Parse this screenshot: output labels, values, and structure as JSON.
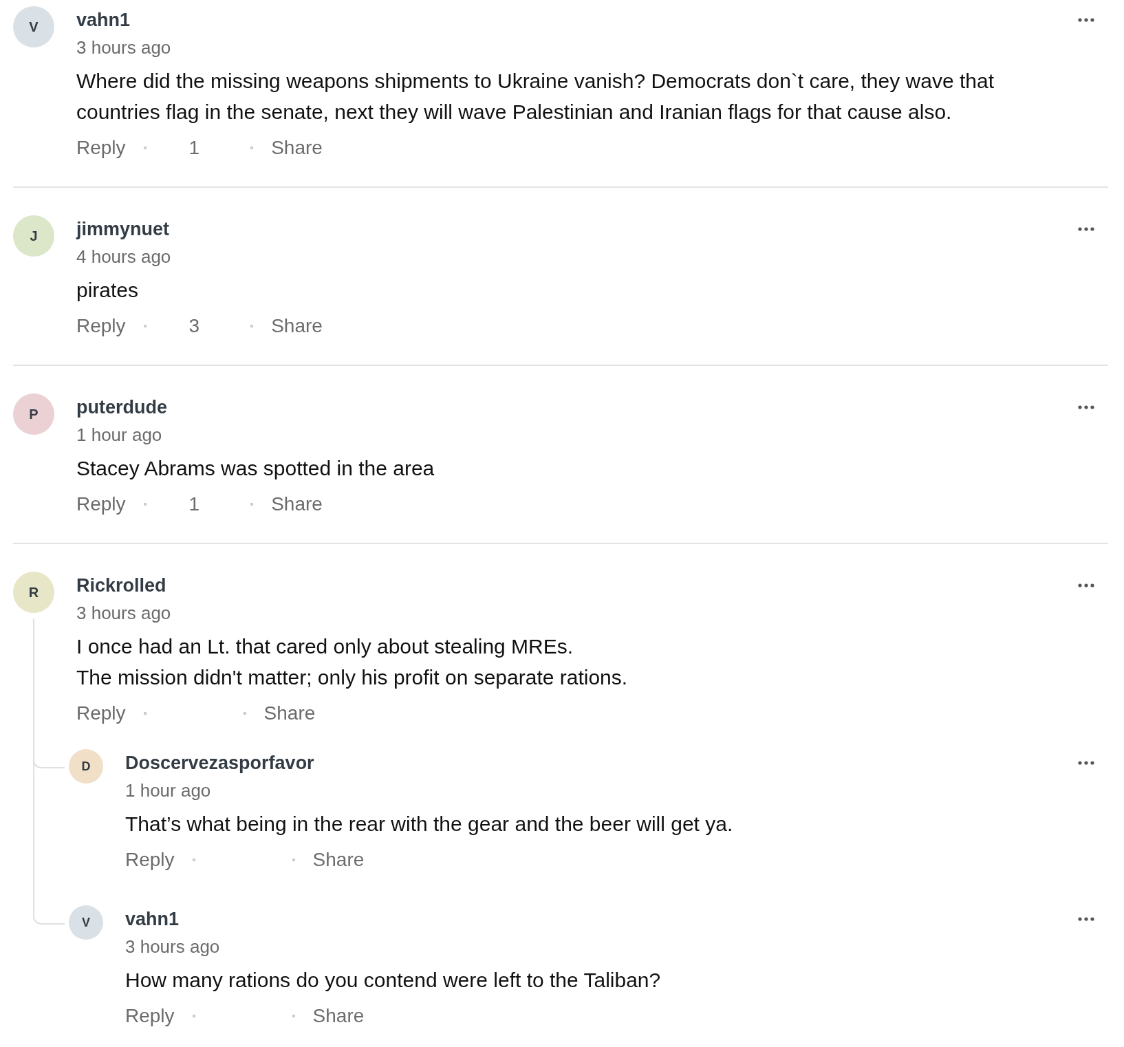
{
  "comments": [
    {
      "author": "vahn1",
      "initial": "V",
      "color": "#d9e1e6",
      "time": "3 hours ago",
      "body": [
        "Where did the missing weapons shipments to Ukraine vanish? Democrats don`t care, they wave that countries flag in the senate, next they will wave Palestinian and Iranian flags for that cause also."
      ],
      "reply": "Reply",
      "count": "1",
      "share": "Share"
    },
    {
      "author": "jimmynuet",
      "initial": "J",
      "color": "#dce6c9",
      "time": "4 hours ago",
      "body": [
        "pirates"
      ],
      "reply": "Reply",
      "count": "3",
      "share": "Share"
    },
    {
      "author": "puterdude",
      "initial": "P",
      "color": "#ecd1d4",
      "time": "1 hour ago",
      "body": [
        "Stacey Abrams was spotted in the area"
      ],
      "reply": "Reply",
      "count": "1",
      "share": "Share"
    },
    {
      "author": "Rickrolled",
      "initial": "R",
      "color": "#e7e7c7",
      "time": "3 hours ago",
      "body": [
        "I once had an Lt. that cared only about stealing MREs.",
        "The mission didn't matter; only his profit on separate rations."
      ],
      "reply": "Reply",
      "share": "Share",
      "replies": [
        {
          "author": "Doscervezasporfavor",
          "initial": "D",
          "color": "#f1dfc8",
          "time": "1 hour ago",
          "body": [
            "That’s what being in the rear with the gear and the beer will get ya."
          ],
          "reply": "Reply",
          "share": "Share"
        },
        {
          "author": "vahn1",
          "initial": "V",
          "color": "#d9e1e6",
          "time": "3 hours ago",
          "body": [
            "How many rations do you contend were left to the Taliban?"
          ],
          "reply": "Reply",
          "share": "Share"
        }
      ]
    }
  ]
}
